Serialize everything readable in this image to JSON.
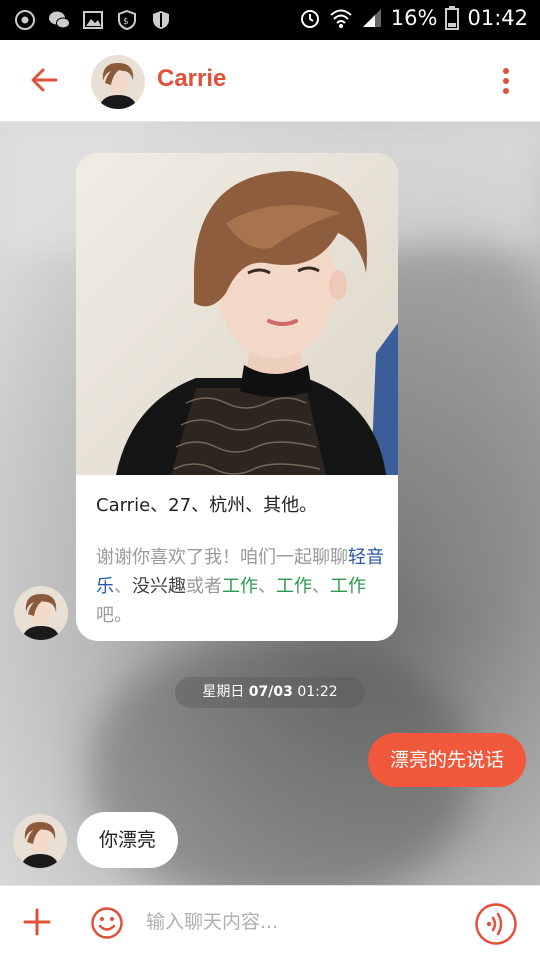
{
  "status_bar": {
    "battery": "16%",
    "time": "01:42",
    "left_icons": [
      "camera-icon",
      "wechat-icon",
      "gallery-icon",
      "shield-icon",
      "shield-alt-icon"
    ],
    "right_icons": [
      "alarm-icon",
      "wifi-icon",
      "signal-icon",
      "battery-icon"
    ]
  },
  "header": {
    "title": "Carrie",
    "accent": "#e0513a"
  },
  "card": {
    "info": {
      "name": "Carrie",
      "sep1": "、",
      "age": "27",
      "sep2": "、",
      "city": "杭州",
      "sep3": "、",
      "other": "其他。"
    },
    "message": {
      "part1": "谢谢你喜欢了我！咱们一起聊聊",
      "tag1": "轻音乐",
      "sep1": "、",
      "tag2": "没兴趣",
      "connector": "或者",
      "tag3": "工作",
      "sep2": "、",
      "tag4": "工作",
      "sep3": "、",
      "tag5": "工作",
      "end": "吧。"
    }
  },
  "timestamp": {
    "weekday": "星期日",
    "date": "07/03",
    "time": "01:22"
  },
  "messages": [
    {
      "direction": "outgoing",
      "text": "漂亮的先说话"
    },
    {
      "direction": "incoming",
      "text": "你漂亮"
    }
  ],
  "input_bar": {
    "placeholder": "输入聊天内容..."
  },
  "colors": {
    "outgoing_bubble": "#f0583c",
    "tag_blue": "#2a5aa8",
    "tag_green": "#2e9a4f"
  }
}
